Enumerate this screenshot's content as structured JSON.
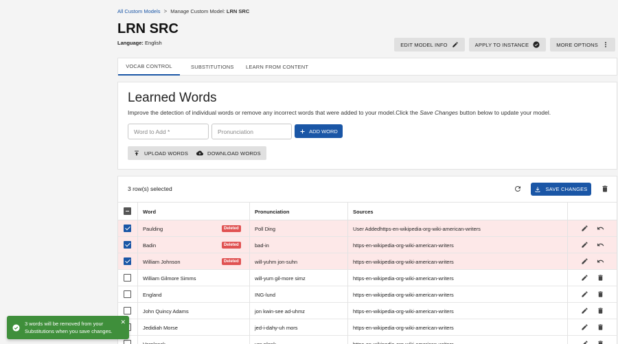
{
  "breadcrumb": {
    "root": "All Custom Models",
    "separator": ">",
    "current_prefix": "Manage Custom Model:",
    "current_model": "LRN SRC"
  },
  "header": {
    "title": "LRN SRC",
    "language_label": "Language:",
    "language_value": "English"
  },
  "actions": {
    "edit_model_info": "EDIT MODEL INFO",
    "apply_to_instance": "APPLY TO INSTANCE",
    "more_options": "MORE OPTIONS"
  },
  "tabs": [
    {
      "label": "VOCAB CONTROL",
      "active": true
    },
    {
      "label": "SUBSTITUTIONS",
      "active": false
    },
    {
      "label": "LEARN FROM CONTENT",
      "active": false
    }
  ],
  "learned": {
    "title": "Learned Words",
    "desc_before": "Improve the detection of individual words or remove any incorrect words that were added to your model.Click the ",
    "desc_italic": "Save Changes",
    "desc_after": " button below to update your model.",
    "word_placeholder": "Word to Add *",
    "pron_placeholder": "Pronunciation",
    "add_word": "ADD WORD",
    "upload_words": "UPLOAD WORDS",
    "download_words": "DOWNLOAD WORDS"
  },
  "table": {
    "selected_text": "3 row(s) selected",
    "save_changes": "SAVE CHANGES",
    "headers": {
      "word": "Word",
      "pronunciation": "Pronunciation",
      "sources": "Sources"
    },
    "deleted_badge": "Deleted",
    "rows": [
      {
        "word": "Paulding",
        "pronunciation": "Poll Ding",
        "sources": "User Addedhttps-en-wikipedia-org-wiki-american-writers",
        "checked": true,
        "deleted": true
      },
      {
        "word": "Badin",
        "pronunciation": "bad-in",
        "sources": "https-en-wikipedia-org-wiki-american-writers",
        "checked": true,
        "deleted": true
      },
      {
        "word": "William Johnson",
        "pronunciation": "will-yuhm jon-suhn",
        "sources": "https-en-wikipedia-org-wiki-american-writers",
        "checked": true,
        "deleted": true
      },
      {
        "word": "William Gilmore Simms",
        "pronunciation": "will-yum gil-more simz",
        "sources": "https-en-wikipedia-org-wiki-american-writers",
        "checked": false,
        "deleted": false
      },
      {
        "word": "England",
        "pronunciation": "ING-lund",
        "sources": "https-en-wikipedia-org-wiki-american-writers",
        "checked": false,
        "deleted": false
      },
      {
        "word": "John Quincy Adams",
        "pronunciation": "jon kwin-see ad-uhmz",
        "sources": "https-en-wikipedia-org-wiki-american-writers",
        "checked": false,
        "deleted": false
      },
      {
        "word": "Jedidiah Morse",
        "pronunciation": "jed-i-dahy-uh mors",
        "sources": "https-en-wikipedia-org-wiki-american-writers",
        "checked": false,
        "deleted": false
      },
      {
        "word": "Verplanck",
        "pronunciation": "ver-plank",
        "sources": "https-en-wikipedia-org-wiki-american-writers",
        "checked": false,
        "deleted": false
      }
    ]
  },
  "toast": {
    "message": "3 words will be removed from your Substitutions when you save changes.",
    "close": "✕"
  },
  "colors": {
    "primary": "#1a56a6",
    "deleted_row": "#fde8e8",
    "deleted_badge": "#e05252",
    "toast": "#3f8f3b"
  }
}
